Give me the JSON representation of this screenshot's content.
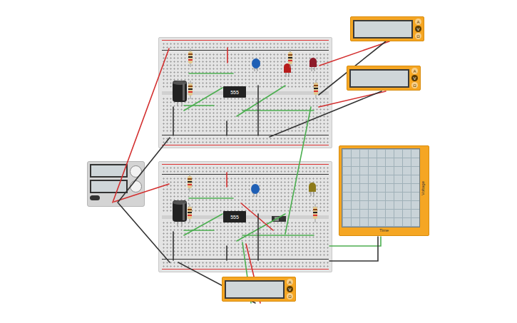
{
  "breadboards": [
    {
      "chip": "555"
    },
    {
      "chip": "555"
    }
  ],
  "multimeters": [
    {
      "modes": [
        {
          "label": "A",
          "selected": false
        },
        {
          "label": "V",
          "selected": true
        },
        {
          "label": "Ω",
          "selected": false
        }
      ]
    },
    {
      "modes": [
        {
          "label": "A",
          "selected": false
        },
        {
          "label": "V",
          "selected": true
        },
        {
          "label": "Ω",
          "selected": false
        }
      ]
    },
    {
      "modes": [
        {
          "label": "A",
          "selected": false
        },
        {
          "label": "V",
          "selected": true
        },
        {
          "label": "Ω",
          "selected": false
        }
      ]
    }
  ],
  "oscilloscope": {
    "y_axis": "Voltage",
    "x_axis": "Time"
  }
}
